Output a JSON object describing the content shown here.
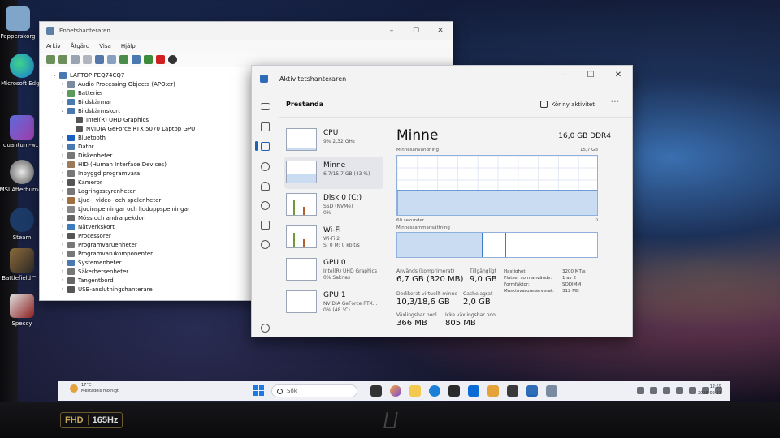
{
  "desktop": {
    "icons": [
      {
        "label": "Papperskorg",
        "icon": "recycle-bin-icon"
      },
      {
        "label": "Microsoft Edge",
        "icon": "edge-icon"
      },
      {
        "label": "quantum-w...",
        "icon": "quantum-icon"
      },
      {
        "label": "MSI Afterburner",
        "icon": "msi-afterburner-icon"
      },
      {
        "label": "Steam",
        "icon": "steam-icon"
      },
      {
        "label": "Battlefield™ 6",
        "icon": "battlefield-icon"
      },
      {
        "label": "Speccy",
        "icon": "speccy-icon"
      }
    ],
    "bezel": {
      "badge_left": "FHD",
      "badge_right": "165Hz"
    }
  },
  "device_manager": {
    "title": "Enhetshanteraren",
    "menu": [
      "Arkiv",
      "Åtgärd",
      "Visa",
      "Hjälp"
    ],
    "tree": [
      {
        "label": "LAPTOP-PEQ74CQ7",
        "level": 0,
        "expanded": true
      },
      {
        "label": "Audio Processing Objects (APO:er)",
        "level": 1
      },
      {
        "label": "Batterier",
        "level": 1
      },
      {
        "label": "Bildskärmar",
        "level": 1
      },
      {
        "label": "Bildskärmskort",
        "level": 1,
        "expanded": true
      },
      {
        "label": "Intel(R) UHD Graphics",
        "level": 2
      },
      {
        "label": "NVIDIA GeForce RTX 5070 Laptop GPU",
        "level": 2
      },
      {
        "label": "Bluetooth",
        "level": 1
      },
      {
        "label": "Dator",
        "level": 1
      },
      {
        "label": "Diskenheter",
        "level": 1
      },
      {
        "label": "HID (Human Interface Devices)",
        "level": 1
      },
      {
        "label": "Inbyggd programvara",
        "level": 1
      },
      {
        "label": "Kameror",
        "level": 1
      },
      {
        "label": "Lagringsstyrenheter",
        "level": 1
      },
      {
        "label": "Ljud-, video- och spelenheter",
        "level": 1
      },
      {
        "label": "Ljudinspelningar och ljuduppspelningar",
        "level": 1
      },
      {
        "label": "Möss och andra pekdon",
        "level": 1
      },
      {
        "label": "Nätverkskort",
        "level": 1
      },
      {
        "label": "Processorer",
        "level": 1
      },
      {
        "label": "Programvaruenheter",
        "level": 1
      },
      {
        "label": "Programvarukomponenter",
        "level": 1
      },
      {
        "label": "Systemenheter",
        "level": 1
      },
      {
        "label": "Säkerhetsenheter",
        "level": 1
      },
      {
        "label": "Tangentbord",
        "level": 1
      },
      {
        "label": "USB-anslutningshanterare",
        "level": 1
      }
    ]
  },
  "task_manager": {
    "title": "Aktivitetshanteraren",
    "page_heading": "Prestanda",
    "run_task_label": "Kör ny aktivitet",
    "more_label": "···",
    "resources": [
      {
        "name": "CPU",
        "sub": "9% 2,32 GHz",
        "selected": false
      },
      {
        "name": "Minne",
        "sub": "6,7/15,7 GB (43 %)",
        "selected": true
      },
      {
        "name": "Disk 0 (C:)",
        "sub": "SSD (NVMe)\n0%",
        "selected": false
      },
      {
        "name": "Wi-Fi",
        "sub": "Wi-Fi 2\nS: 0 M: 0 kbit/s",
        "selected": false
      },
      {
        "name": "GPU 0",
        "sub": "Intel(R) UHD Graphics\n0% Saknas",
        "selected": false
      },
      {
        "name": "GPU 1",
        "sub": "NVIDIA GeForce RTX...\n0% (48 °C)",
        "selected": false
      }
    ],
    "memory": {
      "title": "Minne",
      "capacity": "16,0 GB DDR4",
      "usage_label": "Minnesanvändning",
      "usage_max": "15,7 GB",
      "time_label": "60 sekunder",
      "time_zero": "0",
      "usage_fraction": 0.43,
      "composition_label": "Minnessammansättning",
      "in_use_label": "Används (komprimerat)",
      "in_use_value": "6,7 GB (320 MB)",
      "available_label": "Tillgängligt",
      "available_value": "9,0 GB",
      "committed_label": "Dedikerat virtuellt minne",
      "committed_value": "10,3/18,6 GB",
      "cached_label": "Cachelagrat",
      "cached_value": "2,0 GB",
      "paged_label": "Växlingsbar pool",
      "paged_value": "366 MB",
      "nonpaged_label": "Icke växlingsbar pool",
      "nonpaged_value": "805 MB",
      "details": [
        {
          "k": "Hastighet:",
          "v": "3200 MT/s"
        },
        {
          "k": "Platser som används:",
          "v": "1 av 2"
        },
        {
          "k": "Formfaktor:",
          "v": "SODIMM"
        },
        {
          "k": "Maskinvarureserverat:",
          "v": "312 MB"
        }
      ]
    }
  },
  "taskbar": {
    "weather_temp": "17°C",
    "weather_desc": "Mestadels molnigt",
    "search_placeholder": "Sök",
    "clock_time": "12:59",
    "clock_date": "2026-09-13"
  }
}
